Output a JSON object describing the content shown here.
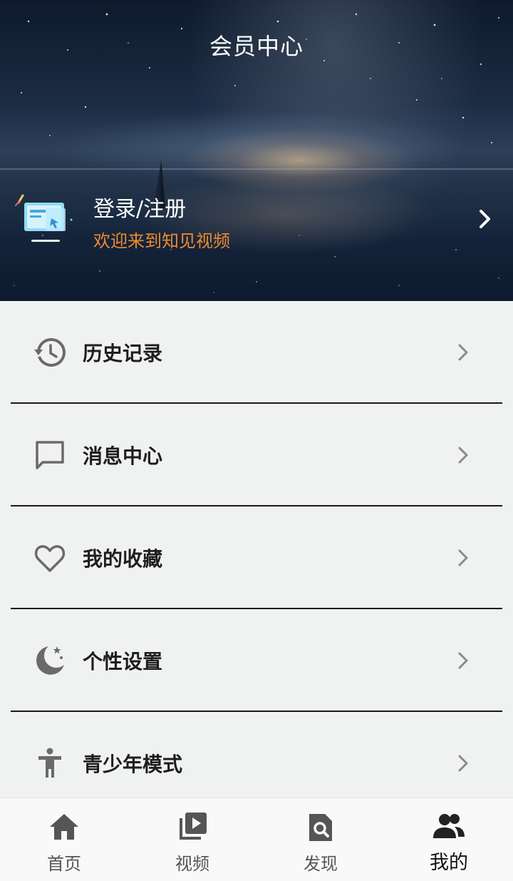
{
  "header": {
    "title": "会员中心",
    "login_title": "登录/注册",
    "login_subtitle": "欢迎来到知见视频",
    "subtitle_color": "#ef8a2e"
  },
  "menu": {
    "items": [
      {
        "label": "历史记录",
        "icon": "history-icon"
      },
      {
        "label": "消息中心",
        "icon": "message-icon"
      },
      {
        "label": "我的收藏",
        "icon": "heart-icon"
      },
      {
        "label": "个性设置",
        "icon": "moon-icon"
      },
      {
        "label": "青少年模式",
        "icon": "accessibility-icon"
      }
    ]
  },
  "bottom_nav": {
    "items": [
      {
        "label": "首页",
        "icon": "home-icon"
      },
      {
        "label": "视频",
        "icon": "video-library-icon"
      },
      {
        "label": "发现",
        "icon": "find-in-page-icon"
      },
      {
        "label": "我的",
        "icon": "people-icon",
        "active": true
      }
    ]
  }
}
